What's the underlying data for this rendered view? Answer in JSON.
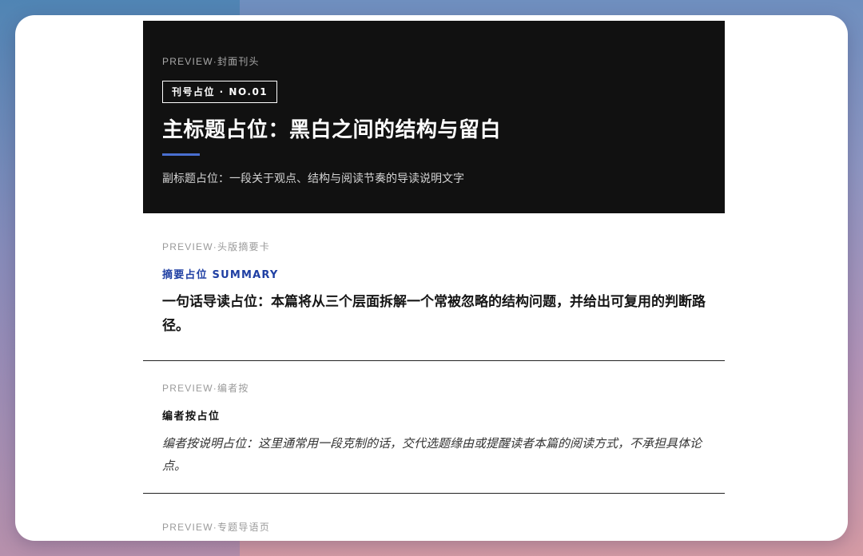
{
  "cover": {
    "preview_label": "PREVIEW·封面刊头",
    "issue_badge": "刊号占位 · NO.01",
    "main_title": "主标题占位：黑白之间的结构与留白",
    "subtitle": "副标题占位：一段关于观点、结构与阅读节奏的导读说明文字",
    "accent_color": "#4a6fd0",
    "background_color": "#111111"
  },
  "summary_card": {
    "preview_label": "PREVIEW·头版摘要卡",
    "label": "摘要占位 SUMMARY",
    "label_color": "#1f3fa3",
    "lead": "一句话导读占位：本篇将从三个层面拆解一个常被忽略的结构问题，并给出可复用的判断路径。"
  },
  "editor_note": {
    "preview_label": "PREVIEW·编者按",
    "label": "编者按占位",
    "text": "编者按说明占位：这里通常用一段克制的话，交代选题缘由或提醒读者本篇的阅读方式，不承担具体论点。"
  },
  "topic_intro": {
    "preview_label": "PREVIEW·专题导语页"
  }
}
